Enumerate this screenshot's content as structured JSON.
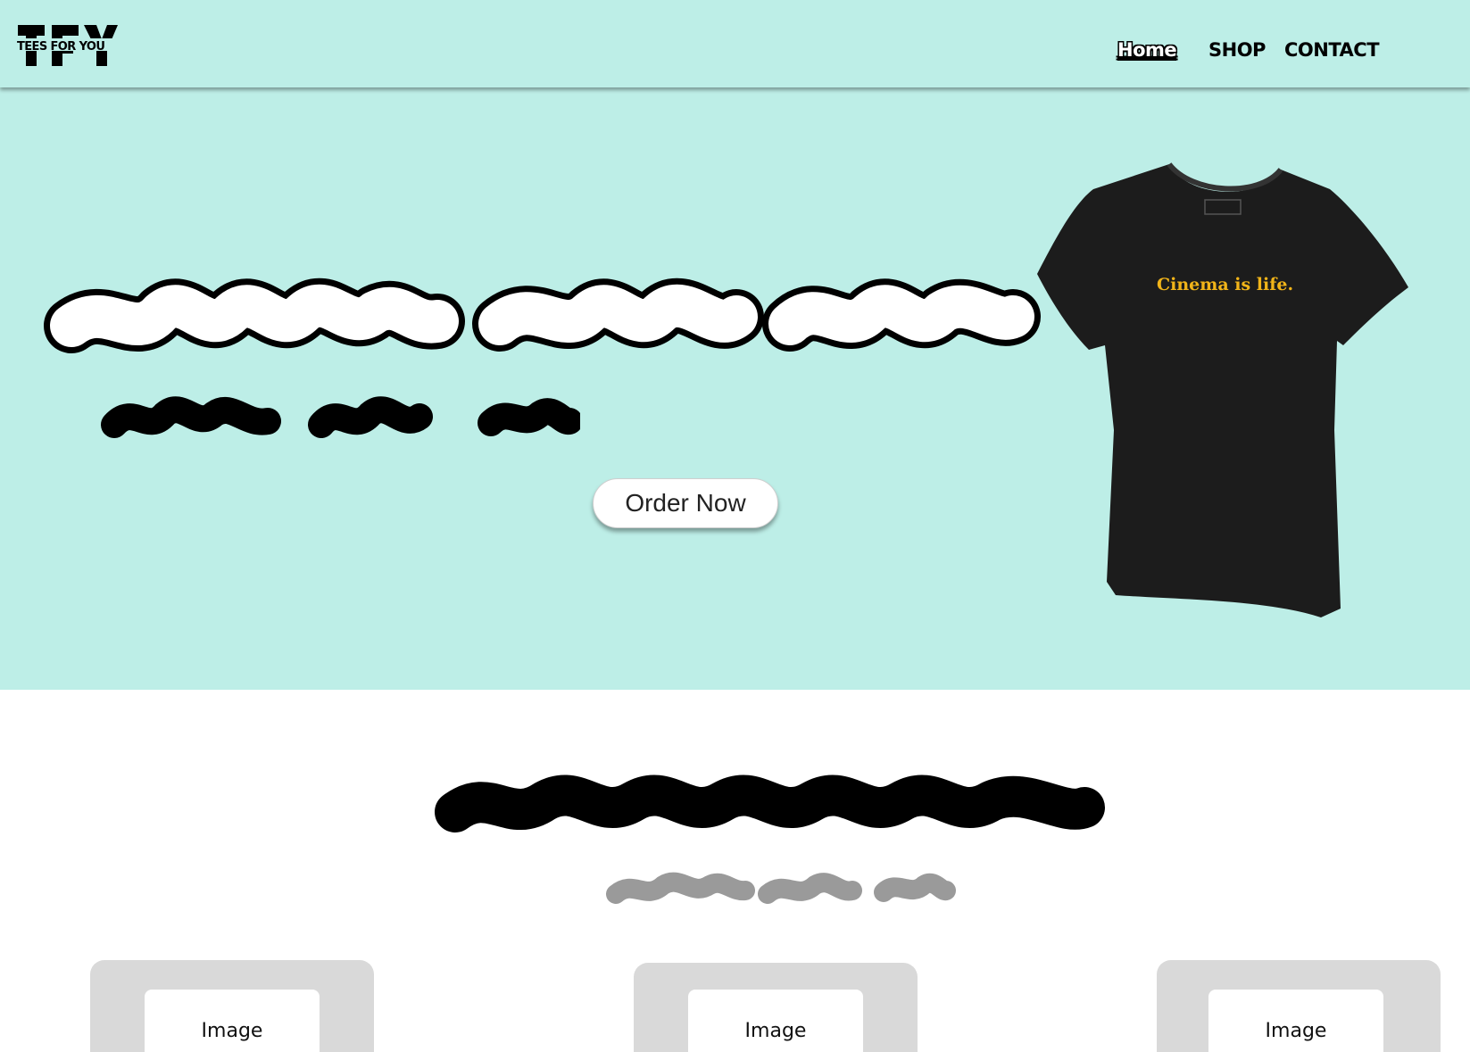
{
  "header": {
    "logo_text": "TEES FOR YOU",
    "logo_mark": "TFY",
    "nav": {
      "home": "Home",
      "shop": "SHOP",
      "contact": "CONTACT"
    }
  },
  "hero": {
    "cta_label": "Order Now",
    "product_print": "Cinema is life."
  },
  "products": {
    "cards": [
      {
        "label": "Image"
      },
      {
        "label": "Image"
      },
      {
        "label": "Image"
      }
    ]
  },
  "colors": {
    "background_mint": "#bdeee7",
    "accent_yellow": "#f1b419",
    "placeholder_gray": "#d9d9d9"
  }
}
